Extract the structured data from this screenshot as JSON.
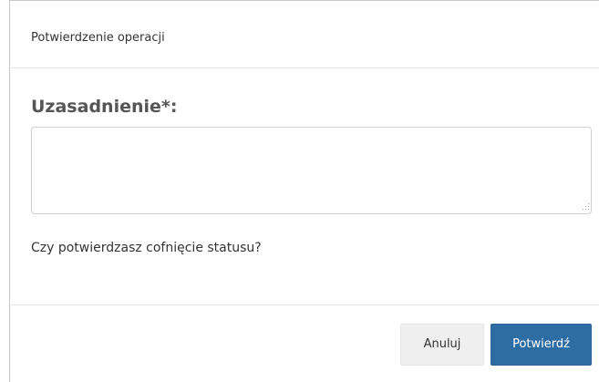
{
  "dialog": {
    "title": "Potwierdzenie operacji",
    "field_label": "Uzasadnienie*:",
    "justification_value": "",
    "question": "Czy potwierdzasz cofnięcie statusu?",
    "buttons": {
      "cancel_label": "Anuluj",
      "confirm_label": "Potwierdź"
    }
  },
  "colors": {
    "confirm_button": "#2e6da4",
    "cancel_button": "#efefef"
  }
}
